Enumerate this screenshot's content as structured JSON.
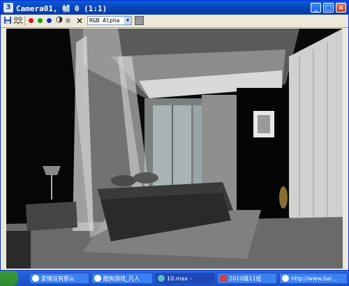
{
  "window": {
    "title": "Camera01, 帧 0 (1:1)",
    "title_icon": "3",
    "controls": {
      "minimize": "_",
      "maximize": "□",
      "close": "×"
    }
  },
  "toolbar": {
    "icons": [
      "save-icon",
      "clone-icon",
      "red-channel-icon",
      "green-channel-icon",
      "blue-channel-icon",
      "mono-channel-icon",
      "alpha-dot-icon",
      "clear-icon"
    ],
    "channel_select": "RGB Alpha",
    "colors": {
      "red": "#e01010",
      "green": "#10a010",
      "blue": "#1030d0"
    }
  },
  "taskbar": {
    "items": [
      {
        "label": "爱情没有那么",
        "icon": "ie-icon"
      },
      {
        "label": "酷狗游戏_凡人",
        "icon": "ie-icon"
      },
      {
        "label": "10.max  -",
        "icon": "max-icon"
      },
      {
        "label": "2010级11班",
        "icon": "word-icon"
      },
      {
        "label": "http://www.bai...",
        "icon": "ie-icon"
      }
    ]
  }
}
